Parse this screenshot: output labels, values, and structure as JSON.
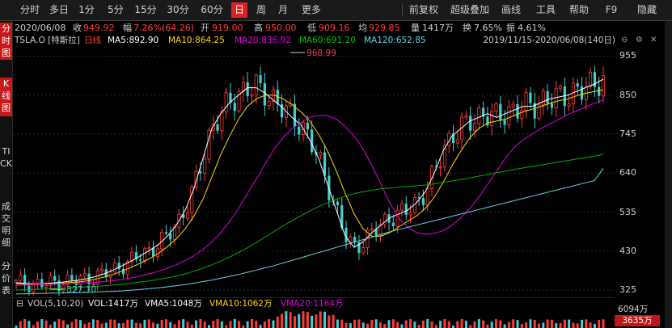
{
  "toolbar": {
    "periods": [
      "分时",
      "多日",
      "1分",
      "5分",
      "15分",
      "30分",
      "60分",
      "日",
      "周",
      "月",
      "更多"
    ],
    "active_period": "日",
    "right_tools": [
      "前复权",
      "超级叠加",
      "画线",
      "工具",
      "帮助",
      "F9",
      "隐藏"
    ]
  },
  "quote": {
    "date": "2020/06/08",
    "close_label": "收",
    "close": "949.92",
    "change_label": "幅",
    "change": "7.26%(64.26)",
    "open_label": "开",
    "open": "919.00",
    "high_label": "高",
    "high": "950.00",
    "low_label": "低",
    "low": "909.16",
    "avg_label": "均",
    "avg": "929.85",
    "volume_label": "量",
    "volume": "1417万",
    "turnover_label": "换",
    "turnover": "7.65%",
    "amplitude_label": "振",
    "amplitude": "4.61%"
  },
  "left_tabs": [
    "分时图",
    "K线图",
    "TICK",
    "成交明细",
    "分价表"
  ],
  "info": {
    "symbol": "TSLA.O [特斯拉]",
    "kline": "日线",
    "ma5": "MA5:892.90",
    "ma10": "MA10:864.25",
    "ma20": "MA20:836.92",
    "ma60": "MA60:691.20",
    "ma120": "MA120:652.85",
    "period": "2019/11/15-2020/06/08(140日)",
    "colors": {
      "ma5": "#ffffff",
      "ma10": "#ffd700",
      "ma20": "#e000e0",
      "ma60": "#00b000",
      "ma120": "#6ad3e0",
      "up": "#ff3b3b",
      "down": "#40d0d0"
    }
  },
  "chart": {
    "high_marker": "968.99",
    "low_marker": "327.10",
    "y_ticks": [
      "955",
      "850",
      "745",
      "640",
      "535",
      "430",
      "325"
    ]
  },
  "chart_data": {
    "type": "line",
    "title": "TSLA.O 日线",
    "ylim": [
      310,
      980
    ],
    "x_range": [
      "2019/11/15",
      "2020/06/08"
    ],
    "series": [
      {
        "name": "MA5",
        "values": [
          345,
          343,
          341,
          342,
          344,
          346,
          349,
          352,
          356,
          362,
          370,
          380,
          392,
          404,
          418,
          432,
          448,
          470,
          500,
          540,
          600,
          680,
          760,
          800,
          830,
          850,
          870,
          870,
          855,
          835,
          815,
          790,
          770,
          730,
          680,
          610,
          540,
          470,
          440,
          455,
          480,
          500,
          520,
          530,
          540,
          560,
          590,
          640,
          700,
          740,
          760,
          780,
          790,
          800,
          790,
          800,
          810,
          820,
          820,
          830,
          840,
          845,
          850,
          860,
          870,
          880,
          892.9
        ]
      },
      {
        "name": "MA10",
        "values": [
          342,
          342,
          341,
          341,
          342,
          343,
          345,
          347,
          350,
          355,
          361,
          368,
          377,
          387,
          398,
          410,
          424,
          442,
          463,
          490,
          525,
          570,
          630,
          690,
          740,
          785,
          820,
          840,
          850,
          850,
          840,
          825,
          805,
          780,
          745,
          700,
          645,
          585,
          530,
          490,
          470,
          470,
          480,
          495,
          510,
          525,
          545,
          575,
          615,
          660,
          700,
          735,
          760,
          775,
          780,
          785,
          795,
          805,
          812,
          820,
          828,
          835,
          840,
          848,
          855,
          860,
          864.25
        ]
      },
      {
        "name": "MA20",
        "values": [
          338,
          339,
          340,
          341,
          341,
          342,
          343,
          344,
          345,
          346,
          348,
          351,
          354,
          358,
          363,
          369,
          376,
          384,
          393,
          405,
          418,
          434,
          455,
          480,
          510,
          545,
          585,
          625,
          665,
          705,
          735,
          760,
          775,
          790,
          795,
          795,
          785,
          765,
          740,
          705,
          660,
          610,
          560,
          520,
          495,
          480,
          475,
          478,
          485,
          500,
          520,
          545,
          575,
          610,
          645,
          680,
          710,
          730,
          745,
          760,
          772,
          785,
          797,
          808,
          818,
          828,
          836.92
        ]
      },
      {
        "name": "MA60",
        "values": [
          325,
          326,
          327,
          328,
          329,
          330,
          331,
          332,
          334,
          335,
          337,
          339,
          341,
          344,
          347,
          350,
          354,
          358,
          363,
          369,
          376,
          384,
          393,
          403,
          414,
          426,
          439,
          453,
          468,
          483,
          498,
          512,
          525,
          538,
          550,
          560,
          570,
          578,
          585,
          590,
          594,
          598,
          600,
          602,
          604,
          606,
          608,
          611,
          615,
          619,
          623,
          627,
          632,
          636,
          641,
          645,
          650,
          654,
          658,
          662,
          666,
          670,
          674,
          678,
          682,
          686,
          691.2
        ]
      },
      {
        "name": "MA120",
        "values": [
          315,
          315,
          316,
          316,
          317,
          317,
          318,
          318,
          319,
          320,
          321,
          322,
          323,
          325,
          327,
          329,
          331,
          334,
          337,
          340,
          344,
          348,
          352,
          357,
          362,
          367,
          373,
          379,
          385,
          391,
          398,
          405,
          412,
          419,
          426,
          433,
          440,
          447,
          454,
          461,
          468,
          475,
          482,
          488,
          494,
          500,
          506,
          512,
          518,
          524,
          530,
          536,
          542,
          548,
          554,
          560,
          566,
          572,
          578,
          584,
          590,
          596,
          602,
          608,
          614,
          620,
          652.85
        ]
      }
    ]
  },
  "volume": {
    "title": "VOL(5,10,20)",
    "vol": "VOL:1417万",
    "vma5": "VMA5:1048万",
    "vma10": "VMA10:1062万",
    "vma20": "VMA20:1164万",
    "axis_label": "6094万",
    "current_box": "3635万",
    "colors": {
      "vol": "#ffffff",
      "vma5": "#ffffff",
      "vma10": "#ffd700",
      "vma20": "#e000e0"
    }
  }
}
